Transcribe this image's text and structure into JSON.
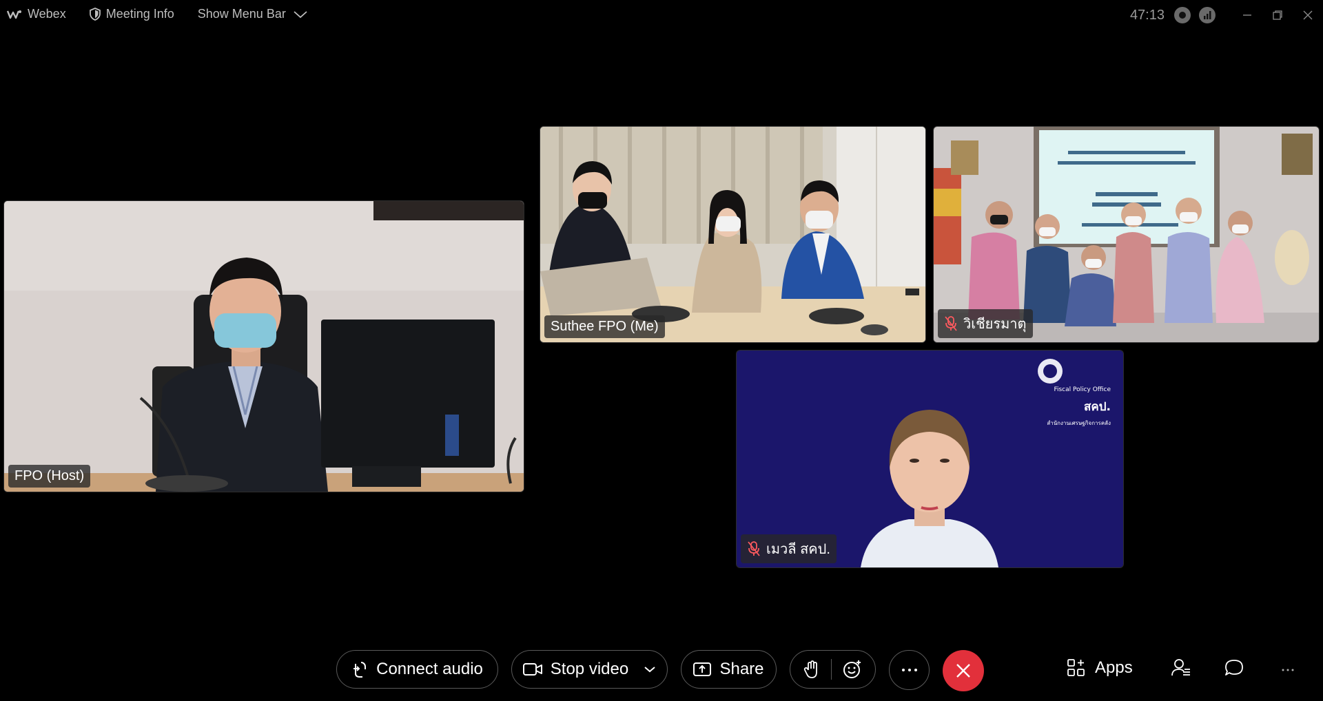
{
  "topbar": {
    "app_name": "Webex",
    "meeting_info": "Meeting Info",
    "show_menu_bar": "Show Menu Bar",
    "timer": "47:13"
  },
  "participants": {
    "host": {
      "name": "FPO (Host)"
    },
    "me": {
      "name": "Suthee FPO (Me)"
    },
    "p2": {
      "name": "วิเชียรมาตุ",
      "muted": true
    },
    "p3": {
      "name": "เมวลี สคป.",
      "muted": true,
      "backdrop_text": [
        "Fiscal Policy Office",
        "สคป.",
        "สำนักงานเศรษฐกิจการคลัง"
      ]
    }
  },
  "toolbar": {
    "connect_audio": "Connect audio",
    "stop_video": "Stop video",
    "share": "Share",
    "apps": "Apps"
  },
  "colors": {
    "background": "#000000",
    "end_call": "#e2303b",
    "tag_bg": "#2a2a2a",
    "muted_icon": "#ff5a5f"
  }
}
